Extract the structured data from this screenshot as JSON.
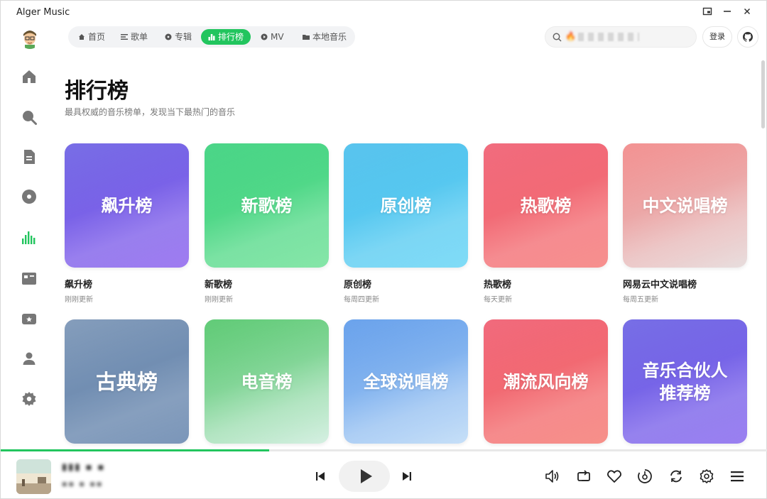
{
  "window": {
    "title": "Alger Music",
    "controls": [
      "restore-icon",
      "minimize-icon",
      "close-icon"
    ]
  },
  "nav": {
    "items": [
      {
        "label": "首页",
        "icon": "home-icon"
      },
      {
        "label": "歌单",
        "icon": "list-icon"
      },
      {
        "label": "专辑",
        "icon": "album-icon"
      },
      {
        "label": "排行榜",
        "icon": "chart-icon",
        "active": true
      },
      {
        "label": "MV",
        "icon": "mv-icon"
      },
      {
        "label": "本地音乐",
        "icon": "folder-icon"
      }
    ],
    "search_placeholder": "🔥 ·",
    "login_label": "登录"
  },
  "sidebar": {
    "items": [
      "home-icon",
      "search-icon",
      "playlist-icon",
      "album-icon",
      "ranking-icon",
      "mv-icon",
      "radio-icon",
      "user-icon",
      "settings-icon"
    ],
    "active": "ranking-icon"
  },
  "page": {
    "title": "排行榜",
    "subtitle": "最具权威的音乐榜单，发现当下最热门的音乐"
  },
  "charts": [
    {
      "cover_text": "飙升榜",
      "name": "飙升榜",
      "update": "刚刚更新",
      "colors": [
        "#5b4ee0",
        "#9f7bf1"
      ]
    },
    {
      "cover_text": "新歌榜",
      "name": "新歌榜",
      "update": "刚刚更新",
      "colors": [
        "#24cc6e",
        "#86e6a8"
      ]
    },
    {
      "cover_text": "原创榜",
      "name": "原创榜",
      "update": "每周四更新",
      "colors": [
        "#35b7ea",
        "#80dcf7"
      ]
    },
    {
      "cover_text": "热歌榜",
      "name": "热歌榜",
      "update": "每天更新",
      "colors": [
        "#ee4c62",
        "#f7908e"
      ]
    },
    {
      "cover_text": "中文说唱榜",
      "name": "网易云中文说唱榜",
      "update": "每周五更新",
      "colors": [
        "#f07b7b",
        "#e8dede"
      ]
    },
    {
      "cover_text": "古典榜",
      "name": "",
      "update": "",
      "colors": [
        "#6a88ad",
        "#7b96b9"
      ]
    },
    {
      "cover_text": "电音榜",
      "name": "",
      "update": "",
      "colors": [
        "#3fc05a",
        "#d6f0e3"
      ]
    },
    {
      "cover_text": "全球说唱榜",
      "name": "",
      "update": "",
      "colors": [
        "#4b8fe8",
        "#c7e0f8"
      ]
    },
    {
      "cover_text": "潮流风向榜",
      "name": "",
      "update": "",
      "colors": [
        "#ee4a60",
        "#f79089"
      ]
    },
    {
      "cover_text": "音乐合伙人推荐榜",
      "name": "",
      "update": "",
      "colors": [
        "#5a4fe0",
        "#9a7ff1"
      ]
    }
  ],
  "player": {
    "song_title": "▮▮▮ ▪ ▪",
    "song_artist": "▪▪ ▪ ▪▪",
    "progress": 0.35,
    "controls": [
      "prev-icon",
      "play-icon",
      "next-icon",
      "volume-icon",
      "loop-icon",
      "heart-icon",
      "speed-icon",
      "repeat-icon",
      "settings-icon",
      "menu-icon"
    ]
  },
  "colors": {
    "accent": "#22c55e"
  }
}
